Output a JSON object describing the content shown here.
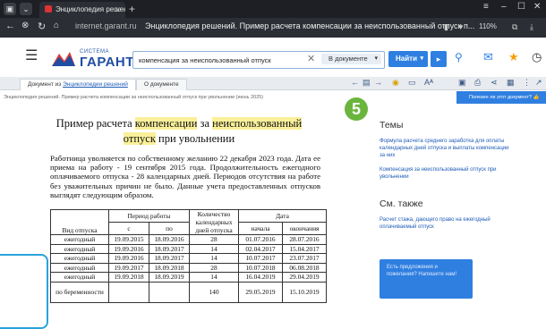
{
  "browser": {
    "tab_title": "Энциклопедия решени",
    "tab_close": "✕",
    "new_tab": "+",
    "url": "internet.garant.ru",
    "page_title": "Энциклопедия решений. Пример расчета компенсации за неиспользованный отпуск п...",
    "zoom": "110%",
    "back": "←",
    "forward": "→",
    "reload": "↻"
  },
  "header": {
    "menu": "☰",
    "logo_small": "СИСТЕМА",
    "logo_name": "ГАРАНТ",
    "search_value": "компенсация за неиспользованный отпуск",
    "search_clear": "✕",
    "scope": "В документе",
    "find": "Найти",
    "find_more": "▸"
  },
  "doctabs": {
    "tab1_prefix": "Документ из",
    "tab1_link": "Энциклопедии решений",
    "tab2": "О документе"
  },
  "breadcrumb": "Энциклопедия решений. Пример расчета компенсации за неиспользованный отпуск при увольнении (июнь 2025)",
  "helpful": "Полезен ли этот документ?",
  "doc": {
    "title1": "Пример расчета ",
    "title_hl1": "компенсации",
    "title2": " за ",
    "title_hl2": "неиспользованный",
    "title_hl3": "отпуск",
    "title3": " при увольнении",
    "paragraph": "Работница уволняется по собственному желанию 22 декабря 2023 года. Дата ее приема на работу - 19 сентября 2015 года. Продолжительность ежегодного оплачиваемого отпуска - 28 календарных дней. Периодов отсутствия на работе без уважительных причин не было. Данные учета предоставленных отпусков выглядят следующим образом.",
    "table": {
      "h_type": "Вид отпуска",
      "h_period": "Период работы",
      "h_from": "с",
      "h_to": "по",
      "h_days": "Количество календарных дней отпуска",
      "h_date": "Дата",
      "h_start": "начала",
      "h_end": "окончания",
      "rows": [
        [
          "ежегодный",
          "19.09.2015",
          "18.09.2016",
          "28",
          "01.07.2016",
          "28.07.2016"
        ],
        [
          "ежегодный",
          "19.09.2016",
          "18.09.2017",
          "14",
          "02.04.2017",
          "15.04.2017"
        ],
        [
          "ежегодный",
          "19.09.2016",
          "18.09.2017",
          "14",
          "10.07.2017",
          "23.07.2017"
        ],
        [
          "ежегодный",
          "19.09.2017",
          "18.09.2018",
          "28",
          "10.07.2018",
          "06.08.2018"
        ],
        [
          "ежегодный",
          "19.09.2018",
          "18.09.2019",
          "14",
          "16.04.2019",
          "29.04.2019"
        ]
      ],
      "last_row_type": "по беременности",
      "last_row_days": "140",
      "last_row_start": "29.05.2019",
      "last_row_end": "15.10.2019"
    }
  },
  "right": {
    "themes_head": "Темы",
    "theme1": "Формула расчета среднего заработка для оплаты календарных дней отпуска и выплаты компенсации за них",
    "theme2": "Компенсация за неиспользованный отпуск при увольнении",
    "see_also_head": "См. также",
    "see1": "Расчет стажа, дающего право на ежегодный оплачиваемый отпуск",
    "feedback": "Есть предложения и пожелания? Напишите нам!"
  },
  "overlay": {
    "step": "5"
  },
  "colors": {
    "accent": "#2f7fe0",
    "highlight": "#faf09a",
    "step_badge": "#6ab53d",
    "callout": "#29a3dc"
  }
}
